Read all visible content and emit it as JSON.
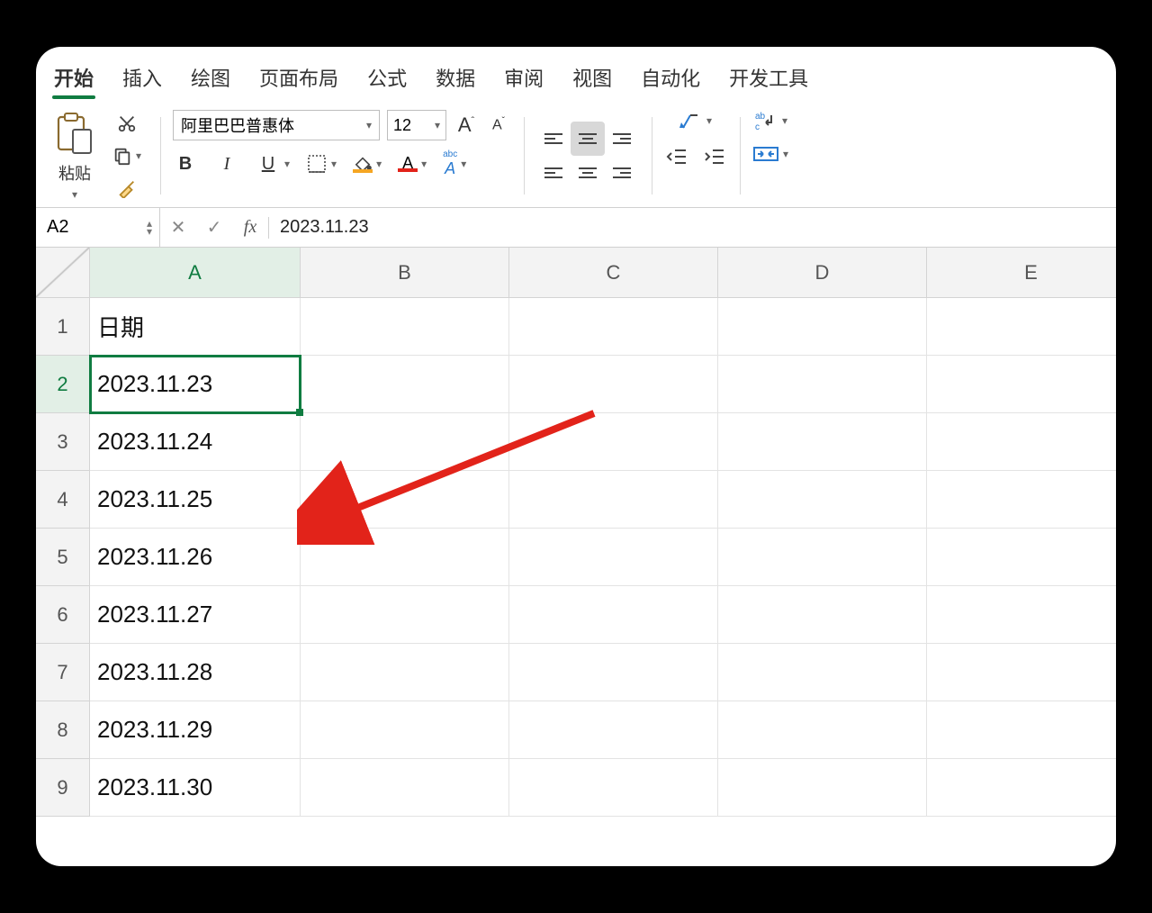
{
  "tabs": {
    "items": [
      "开始",
      "插入",
      "绘图",
      "页面布局",
      "公式",
      "数据",
      "审阅",
      "视图",
      "自动化",
      "开发工具"
    ],
    "active_index": 0
  },
  "ribbon": {
    "paste_label": "粘贴",
    "font_name": "阿里巴巴普惠体",
    "font_size": "12",
    "ruby_label": "abc"
  },
  "formula_bar": {
    "name_box": "A2",
    "fx_label": "fx",
    "formula": "2023.11.23"
  },
  "grid": {
    "columns": [
      "A",
      "B",
      "C",
      "D",
      "E"
    ],
    "rows": [
      "1",
      "2",
      "3",
      "4",
      "5",
      "6",
      "7",
      "8",
      "9"
    ],
    "selected_cell": "A2",
    "data": {
      "A": [
        "日期",
        "2023.11.23",
        "2023.11.24",
        "2023.11.25",
        "2023.11.26",
        "2023.11.27",
        "2023.11.28",
        "2023.11.29",
        "2023.11.30"
      ]
    }
  },
  "annotation": {
    "color": "#e2231a"
  }
}
